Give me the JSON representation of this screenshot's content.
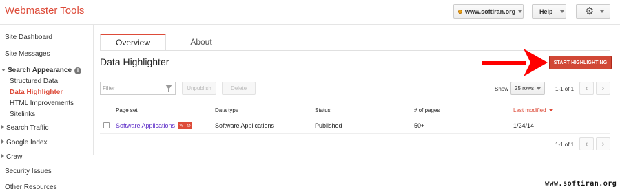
{
  "app": {
    "title": "Webmaster Tools"
  },
  "header": {
    "site": "www.softiran.org",
    "help": "Help"
  },
  "sidebar": {
    "site_dashboard": "Site Dashboard",
    "site_messages": "Site Messages",
    "search_appearance": "Search Appearance",
    "info_glyph": "i",
    "structured_data": "Structured Data",
    "data_highlighter": "Data Highlighter",
    "html_improvements": "HTML Improvements",
    "sitelinks": "Sitelinks",
    "search_traffic": "Search Traffic",
    "google_index": "Google Index",
    "crawl": "Crawl",
    "security_issues": "Security Issues",
    "other_resources": "Other Resources"
  },
  "tabs": {
    "overview": "Overview",
    "about": "About"
  },
  "main": {
    "title": "Data Highlighter",
    "start_button": "START HIGHLIGHTING",
    "filter_placeholder": "Filter",
    "unpublish": "Unpublish",
    "delete": "Delete",
    "show_label": "Show",
    "rows_per_page": "25 rows",
    "pager_top": "1-1 of 1",
    "pager_bottom": "1-1 of 1",
    "prev_glyph": "‹",
    "next_glyph": "›"
  },
  "table": {
    "headers": [
      "Page set",
      "Data type",
      "Status",
      "# of pages",
      "Last modified"
    ],
    "sorted_column": "Last modified",
    "rows": [
      {
        "page_set": "Software Applications",
        "data_type": "Software Applications",
        "status": "Published",
        "pages": "50+",
        "last_modified": "1/24/14"
      }
    ]
  },
  "watermark": "www.softiran.org",
  "colors": {
    "accent": "#dd4b39",
    "button_red": "#d14836",
    "arrow_red": "#ff0000",
    "link": "#5e2ec8"
  },
  "icons": {
    "site_favicon": "favicon-icon",
    "settings": "gear-icon",
    "info": "info-icon",
    "filter": "funnel-icon",
    "edit": "pencil-icon",
    "remove": "circle-x-icon"
  }
}
